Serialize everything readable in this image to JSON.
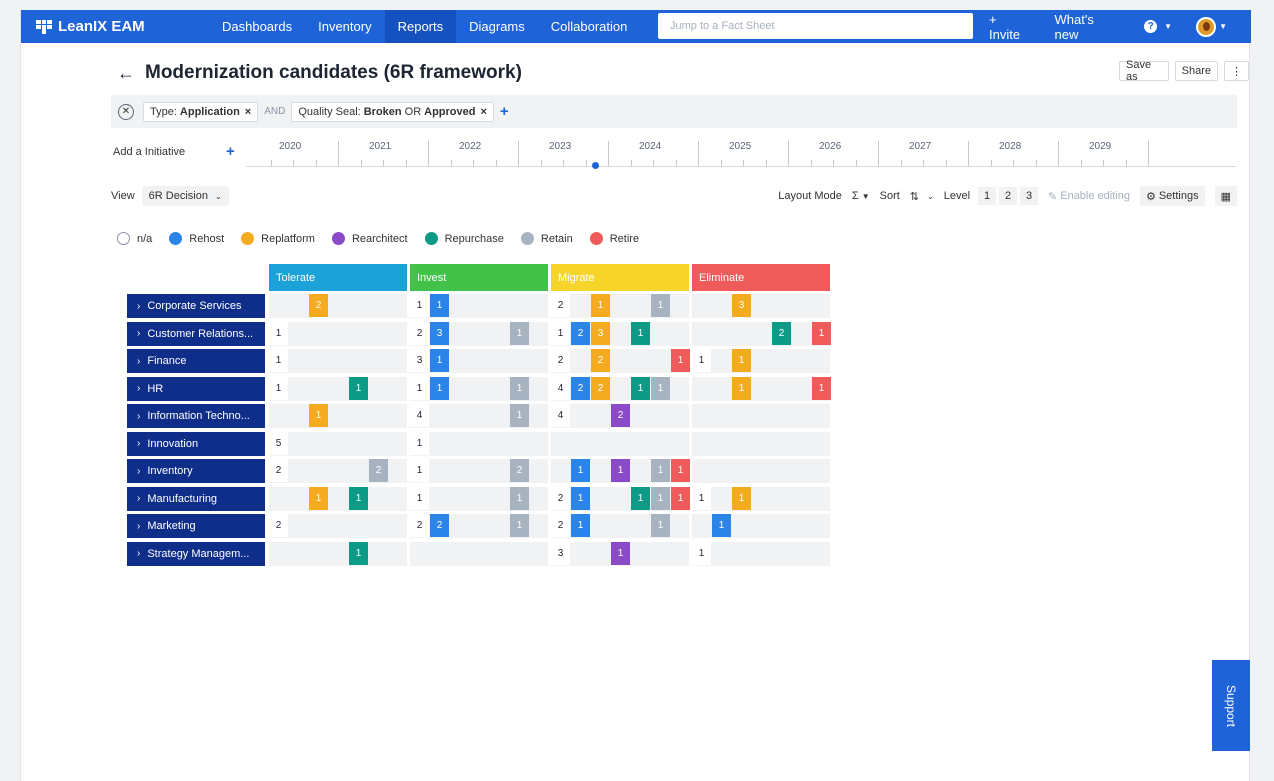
{
  "topbar": {
    "brand": "LeanIX EAM",
    "nav": [
      "Dashboards",
      "Inventory",
      "Reports",
      "Diagrams",
      "Collaboration"
    ],
    "active_nav": "Reports",
    "search_placeholder": "Jump to a Fact Sheet",
    "invite": "+ Invite",
    "whats_new": "What's new",
    "help_icon": "?",
    "accent": "#1e64d8"
  },
  "page": {
    "title": "Modernization candidates (6R framework)",
    "actions": {
      "save_as": "Save as",
      "share": "Share",
      "more": "⋮"
    }
  },
  "filters": {
    "chip1_key": "Type:",
    "chip1_val": "Application",
    "and": "AND",
    "chip2_key": "Quality Seal:",
    "chip2_v1": "Broken",
    "chip2_or": "OR",
    "chip2_v2": "Approved",
    "remove": "×",
    "add": "+"
  },
  "timeline": {
    "add_label": "Add a Initiative",
    "add": "+",
    "years": [
      "2020",
      "2021",
      "2022",
      "2023",
      "2024",
      "2025",
      "2026",
      "2027",
      "2028",
      "2029"
    ],
    "current_year_fraction": 0.38
  },
  "toolbar": {
    "view_label": "View",
    "view_value": "6R Decision",
    "layout_mode": "Layout Mode",
    "layout_icon": "Σ",
    "sort": "Sort",
    "sort_icon": "⇅",
    "level": "Level",
    "levels": [
      "1",
      "2",
      "3"
    ],
    "enable_editing": "Enable editing",
    "settings": "Settings"
  },
  "legend": [
    {
      "label": "n/a",
      "color": "#ffffff"
    },
    {
      "label": "Rehost",
      "color": "#2b85e8"
    },
    {
      "label": "Replatform",
      "color": "#f5ab1f"
    },
    {
      "label": "Rearchitect",
      "color": "#8b4bc9"
    },
    {
      "label": "Repurchase",
      "color": "#0d9a86"
    },
    {
      "label": "Retain",
      "color": "#a8b3c2"
    },
    {
      "label": "Retire",
      "color": "#ef5b5b"
    }
  ],
  "columns": [
    {
      "label": "Tolerate",
      "color": "#1ba2d8"
    },
    {
      "label": "Invest",
      "color": "#43c24a"
    },
    {
      "label": "Migrate",
      "color": "#f7d42a"
    },
    {
      "label": "Eliminate",
      "color": "#ef5b5b"
    }
  ],
  "rows": [
    {
      "label": "Corporate Services",
      "cells": [
        [
          0,
          0,
          2,
          0,
          0,
          0,
          0
        ],
        [
          1,
          1,
          0,
          0,
          0,
          0,
          0
        ],
        [
          2,
          0,
          1,
          0,
          0,
          1,
          0
        ],
        [
          0,
          0,
          3,
          0,
          0,
          0,
          0
        ]
      ]
    },
    {
      "label": "Customer Relations...",
      "cells": [
        [
          1,
          0,
          0,
          0,
          0,
          0,
          0
        ],
        [
          2,
          3,
          0,
          0,
          0,
          1,
          0
        ],
        [
          1,
          2,
          3,
          0,
          1,
          0,
          0
        ],
        [
          0,
          0,
          0,
          0,
          2,
          0,
          1
        ]
      ]
    },
    {
      "label": "Finance",
      "cells": [
        [
          1,
          0,
          0,
          0,
          0,
          0,
          0
        ],
        [
          3,
          1,
          0,
          0,
          0,
          0,
          0
        ],
        [
          2,
          0,
          2,
          0,
          0,
          0,
          1
        ],
        [
          1,
          0,
          1,
          0,
          0,
          0,
          0
        ]
      ]
    },
    {
      "label": "HR",
      "cells": [
        [
          1,
          0,
          0,
          0,
          1,
          0,
          0
        ],
        [
          1,
          1,
          0,
          0,
          0,
          1,
          0
        ],
        [
          4,
          2,
          2,
          0,
          1,
          1,
          0
        ],
        [
          0,
          0,
          1,
          0,
          0,
          0,
          1
        ]
      ]
    },
    {
      "label": "Information Techno...",
      "cells": [
        [
          0,
          0,
          1,
          0,
          0,
          0,
          0
        ],
        [
          4,
          0,
          0,
          0,
          0,
          1,
          0
        ],
        [
          4,
          0,
          0,
          2,
          0,
          0,
          0
        ],
        [
          0,
          0,
          0,
          0,
          0,
          0,
          0
        ]
      ]
    },
    {
      "label": "Innovation",
      "cells": [
        [
          5,
          0,
          0,
          0,
          0,
          0,
          0
        ],
        [
          1,
          0,
          0,
          0,
          0,
          0,
          0
        ],
        [
          0,
          0,
          0,
          0,
          0,
          0,
          0
        ],
        [
          0,
          0,
          0,
          0,
          0,
          0,
          0
        ]
      ]
    },
    {
      "label": "Inventory",
      "cells": [
        [
          2,
          0,
          0,
          0,
          0,
          2,
          0
        ],
        [
          1,
          0,
          0,
          0,
          0,
          2,
          0
        ],
        [
          0,
          1,
          0,
          1,
          0,
          1,
          1
        ],
        [
          0,
          0,
          0,
          0,
          0,
          0,
          0
        ]
      ]
    },
    {
      "label": "Manufacturing",
      "cells": [
        [
          0,
          0,
          1,
          0,
          1,
          0,
          0
        ],
        [
          1,
          0,
          0,
          0,
          0,
          1,
          0
        ],
        [
          2,
          1,
          0,
          0,
          1,
          1,
          1
        ],
        [
          1,
          0,
          1,
          0,
          0,
          0,
          0
        ]
      ]
    },
    {
      "label": "Marketing",
      "cells": [
        [
          2,
          0,
          0,
          0,
          0,
          0,
          0
        ],
        [
          2,
          2,
          0,
          0,
          0,
          1,
          0
        ],
        [
          2,
          1,
          0,
          0,
          0,
          1,
          0
        ],
        [
          0,
          1,
          0,
          0,
          0,
          0,
          0
        ]
      ]
    },
    {
      "label": "Strategy Managem...",
      "cells": [
        [
          0,
          0,
          0,
          0,
          1,
          0,
          0
        ],
        [
          0,
          0,
          0,
          0,
          0,
          0,
          0
        ],
        [
          3,
          0,
          0,
          1,
          0,
          0,
          0
        ],
        [
          1,
          0,
          0,
          0,
          0,
          0,
          0
        ]
      ]
    }
  ],
  "support": "Support"
}
